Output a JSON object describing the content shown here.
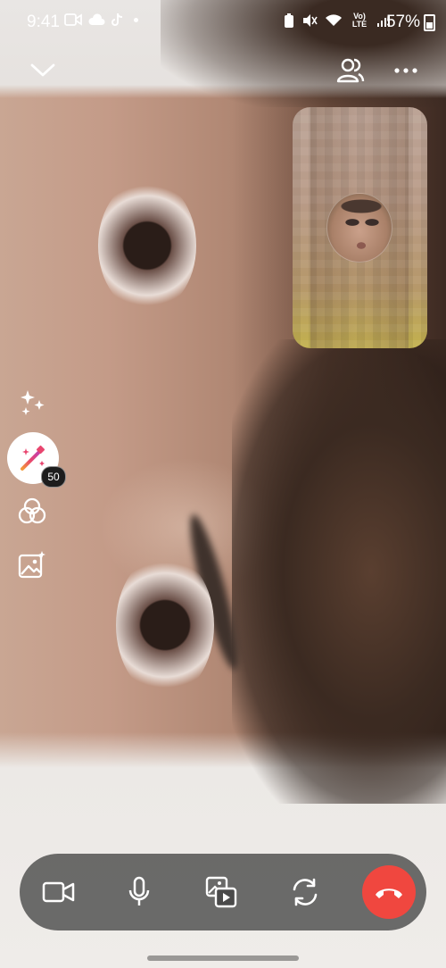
{
  "status_bar": {
    "time": "9:41",
    "battery": "57%",
    "network_label": "Vo) LTE"
  },
  "effects": {
    "badge_count": "50"
  },
  "colors": {
    "end_call": "#f0473f",
    "call_bar": "#373737"
  },
  "icons": {
    "minimize": "chevron-down-icon",
    "participants": "people-icon",
    "more": "more-icon",
    "sparkle": "sparkle-icon",
    "effects": "magic-wand-icon",
    "filters": "filters-icon",
    "background": "background-image-icon",
    "video": "video-camera-icon",
    "mic": "microphone-icon",
    "share": "share-media-icon",
    "flip": "flip-camera-icon",
    "end": "end-call-icon"
  }
}
